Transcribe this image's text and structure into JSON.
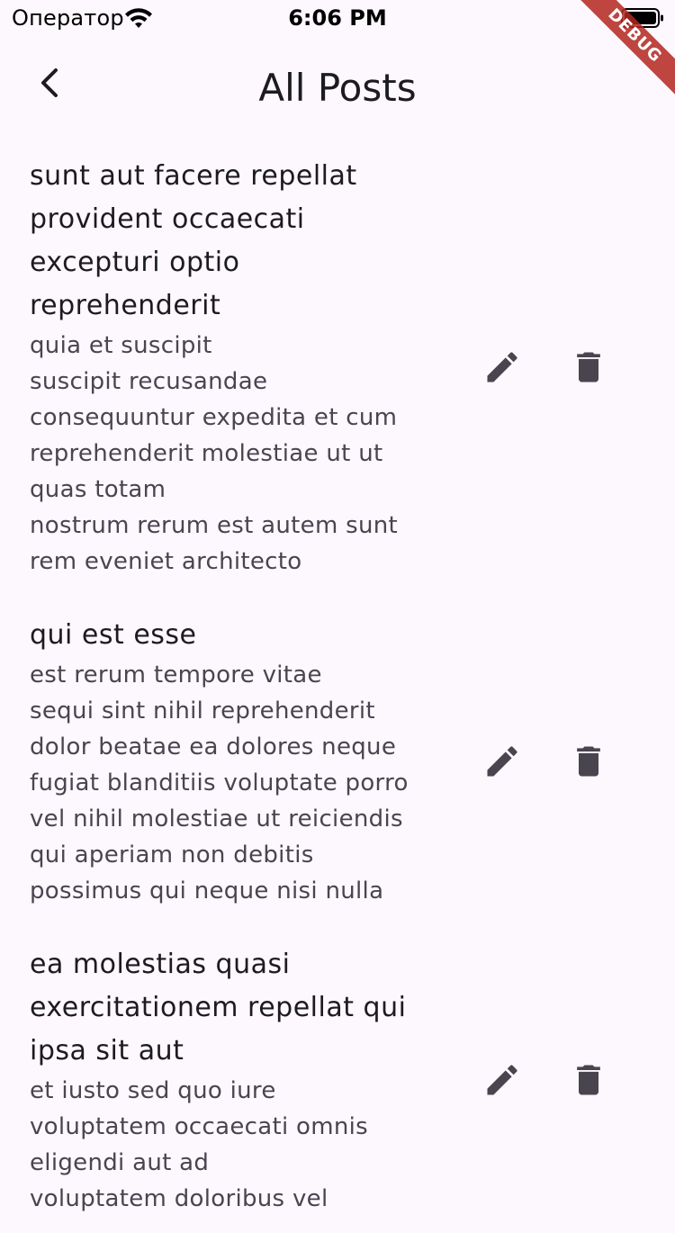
{
  "status_bar": {
    "carrier": "Оператор",
    "time": "6:06 PM",
    "wifi_icon": "wifi-icon",
    "battery_icon": "battery-icon"
  },
  "debug_banner": {
    "label": "DEBUG"
  },
  "app_bar": {
    "back_icon": "chevron-left-icon",
    "title": "All Posts"
  },
  "posts": [
    {
      "title": "sunt aut facere repellat provident occaecati excepturi optio reprehenderit",
      "body": "quia et suscipit\nsuscipit recusandae consequuntur expedita et cum reprehenderit molestiae ut ut quas totam\nnostrum rerum est autem sunt rem eveniet architecto",
      "edit_icon": "pencil-icon",
      "delete_icon": "trash-icon"
    },
    {
      "title": "qui est esse",
      "body": "est rerum tempore vitae\nsequi sint nihil reprehenderit dolor beatae ea dolores neque\nfugiat blanditiis voluptate porro vel nihil molestiae ut reiciendis\nqui aperiam non debitis possimus qui neque nisi nulla",
      "edit_icon": "pencil-icon",
      "delete_icon": "trash-icon"
    },
    {
      "title": "ea molestias quasi exercitationem repellat qui ipsa sit aut",
      "body": "et iusto sed quo iure\nvoluptatem occaecati omnis eligendi aut ad\nvoluptatem doloribus vel",
      "edit_icon": "pencil-icon",
      "delete_icon": "trash-icon"
    }
  ],
  "colors": {
    "background": "#fdf7fe",
    "icon": "#49454f",
    "title_text": "#1c1b1f",
    "body_text": "#49454f",
    "debug_ribbon": "#b3261e"
  }
}
